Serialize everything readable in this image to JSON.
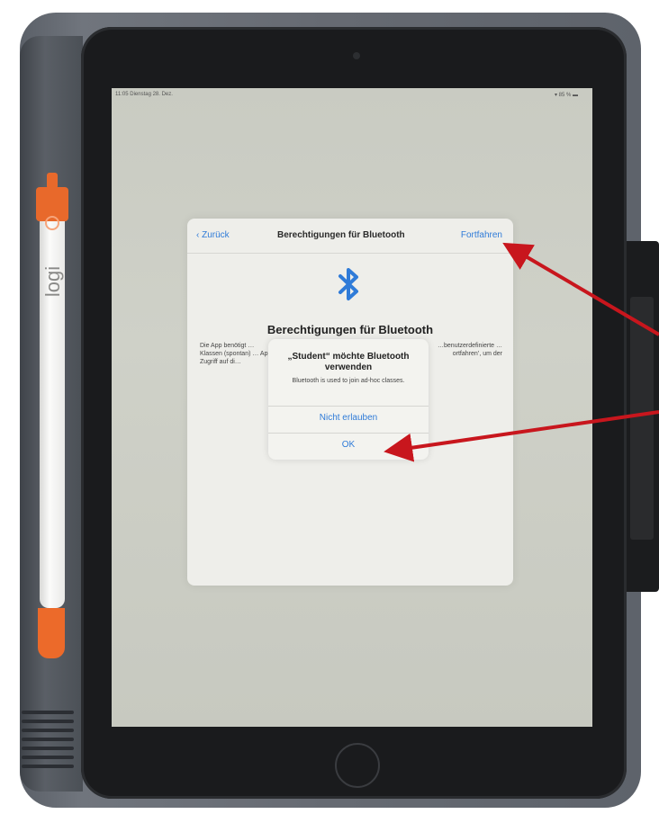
{
  "status_bar": {
    "time": "11:05  Dienstag 28. Dez.",
    "battery": "▾ 85 % ▬"
  },
  "pencil": {
    "brand": "logi"
  },
  "sheet": {
    "nav": {
      "back_label": "‹ Zurück",
      "title": "Berechtigungen für Bluetooth",
      "continue_label": "Fortfahren"
    },
    "icon": "bluetooth-icon",
    "heading": "Berechtigungen für Bluetooth",
    "body_left": "Die App benötigt … Klassen (spontan) … App Zugriff auf di…",
    "body_right": "…benutzerdefinierte …ortfahren’, um der"
  },
  "alert": {
    "title": "„Student“ möchte Bluetooth verwenden",
    "message": "Bluetooth is used to join ad-hoc classes.",
    "deny_label": "Nicht erlauben",
    "ok_label": "OK"
  },
  "colors": {
    "ios_blue": "#2f7bd8",
    "arrow_red": "#c8161d",
    "pencil_orange": "#e8692b"
  }
}
